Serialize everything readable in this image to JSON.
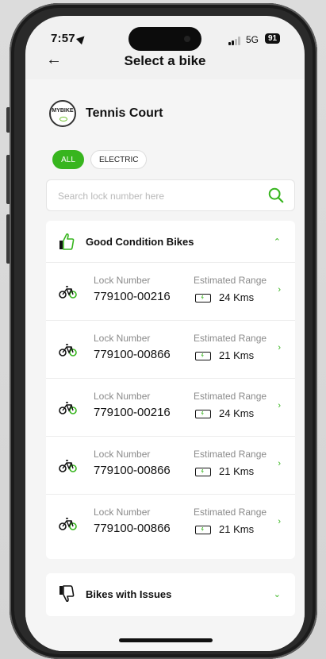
{
  "status": {
    "time": "7:57",
    "network": "5G",
    "battery": "91"
  },
  "header": {
    "title": "Select a bike"
  },
  "location": {
    "name": "Tennis Court",
    "logo_text": "MYBIKE"
  },
  "filters": {
    "chips": [
      "ALL",
      "ELECTRIC"
    ],
    "selected": "ALL"
  },
  "search": {
    "placeholder": "Search lock number here"
  },
  "good": {
    "title": "Good Condition Bikes",
    "lock_label": "Lock Number",
    "range_label": "Estimated Range",
    "bikes": [
      {
        "lock": "779100-00216",
        "range": "24 Kms"
      },
      {
        "lock": "779100-00866",
        "range": "21 Kms"
      },
      {
        "lock": "779100-00216",
        "range": "24 Kms"
      },
      {
        "lock": "779100-00866",
        "range": "21 Kms"
      },
      {
        "lock": "779100-00866",
        "range": "21 Kms"
      }
    ]
  },
  "issues": {
    "title": "Bikes with Issues"
  },
  "colors": {
    "accent": "#37b51e"
  },
  "icons": [
    "back-arrow-icon",
    "search-icon",
    "thumbs-up-icon",
    "thumbs-down-icon",
    "bike-icon",
    "battery-charging-icon",
    "chevron-right-icon",
    "chevron-up-icon",
    "chevron-down-icon"
  ]
}
